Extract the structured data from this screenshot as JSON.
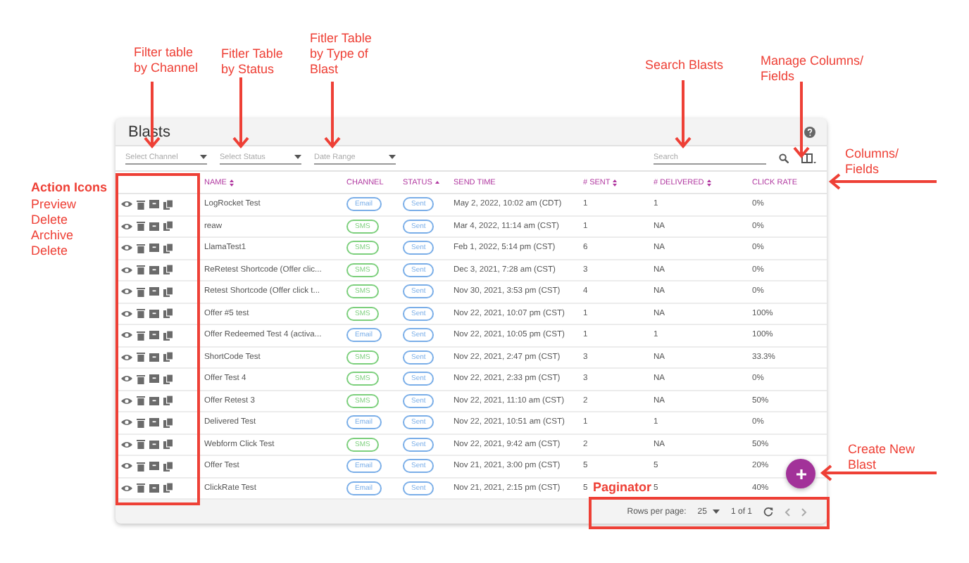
{
  "panel": {
    "title": "Blasts",
    "filters": [
      {
        "placeholder": "Select Channel"
      },
      {
        "placeholder": "Select Status"
      },
      {
        "placeholder": "Date Range"
      }
    ],
    "search": {
      "placeholder": "Search"
    },
    "columns": [
      {
        "label": "NAME",
        "sortable": true,
        "sorted": false
      },
      {
        "label": "CHANNEL",
        "sortable": false
      },
      {
        "label": "STATUS",
        "sortable": true,
        "sorted": true
      },
      {
        "label": "SEND TIME",
        "sortable": false
      },
      {
        "label": "# SENT",
        "sortable": true,
        "sorted": false
      },
      {
        "label": "# DELIVERED",
        "sortable": true,
        "sorted": false
      },
      {
        "label": "CLICK RATE",
        "sortable": false
      }
    ],
    "rows": [
      {
        "name": "LogRocket Test",
        "channel": {
          "label": "Email",
          "color": "#7aaee8"
        },
        "status": "Sent",
        "send_time": "May 2, 2022, 10:02 am (CDT)",
        "sent": "1",
        "delivered": "1",
        "click_rate": "0%"
      },
      {
        "name": "reaw",
        "channel": {
          "label": "SMS",
          "color": "#7ccf7c"
        },
        "status": "Sent",
        "send_time": "Mar 4, 2022, 11:14 am (CST)",
        "sent": "1",
        "delivered": "NA",
        "click_rate": "0%"
      },
      {
        "name": "LlamaTest1",
        "channel": {
          "label": "SMS",
          "color": "#7ccf7c"
        },
        "status": "Sent",
        "send_time": "Feb 1, 2022, 5:14 pm (CST)",
        "sent": "6",
        "delivered": "NA",
        "click_rate": "0%"
      },
      {
        "name": "ReRetest Shortcode (Offer clic...",
        "channel": {
          "label": "SMS",
          "color": "#7ccf7c"
        },
        "status": "Sent",
        "send_time": "Dec 3, 2021, 7:28 am (CST)",
        "sent": "3",
        "delivered": "NA",
        "click_rate": "0%"
      },
      {
        "name": "Retest Shortcode (Offer click t...",
        "channel": {
          "label": "SMS",
          "color": "#7ccf7c"
        },
        "status": "Sent",
        "send_time": "Nov 30, 2021, 3:53 pm (CST)",
        "sent": "4",
        "delivered": "NA",
        "click_rate": "0%"
      },
      {
        "name": "Offer #5 test",
        "channel": {
          "label": "SMS",
          "color": "#7ccf7c"
        },
        "status": "Sent",
        "send_time": "Nov 22, 2021, 10:07 pm (CST)",
        "sent": "1",
        "delivered": "NA",
        "click_rate": "100%"
      },
      {
        "name": "Offer Redeemed Test 4 (activa...",
        "channel": {
          "label": "Email",
          "color": "#7aaee8"
        },
        "status": "Sent",
        "send_time": "Nov 22, 2021, 10:05 pm (CST)",
        "sent": "1",
        "delivered": "1",
        "click_rate": "100%"
      },
      {
        "name": "ShortCode Test",
        "channel": {
          "label": "SMS",
          "color": "#7ccf7c"
        },
        "status": "Sent",
        "send_time": "Nov 22, 2021, 2:47 pm (CST)",
        "sent": "3",
        "delivered": "NA",
        "click_rate": "33.3%"
      },
      {
        "name": "Offer Test 4",
        "channel": {
          "label": "SMS",
          "color": "#7ccf7c"
        },
        "status": "Sent",
        "send_time": "Nov 22, 2021, 2:33 pm (CST)",
        "sent": "3",
        "delivered": "NA",
        "click_rate": "0%"
      },
      {
        "name": "Offer Retest 3",
        "channel": {
          "label": "SMS",
          "color": "#7ccf7c"
        },
        "status": "Sent",
        "send_time": "Nov 22, 2021, 11:10 am (CST)",
        "sent": "2",
        "delivered": "NA",
        "click_rate": "50%"
      },
      {
        "name": "Delivered Test",
        "channel": {
          "label": "Email",
          "color": "#7aaee8"
        },
        "status": "Sent",
        "send_time": "Nov 22, 2021, 10:51 am (CST)",
        "sent": "1",
        "delivered": "1",
        "click_rate": "0%"
      },
      {
        "name": "Webform Click Test",
        "channel": {
          "label": "SMS",
          "color": "#7ccf7c"
        },
        "status": "Sent",
        "send_time": "Nov 22, 2021, 9:42 am (CST)",
        "sent": "2",
        "delivered": "NA",
        "click_rate": "50%"
      },
      {
        "name": "Offer Test",
        "channel": {
          "label": "Email",
          "color": "#7aaee8"
        },
        "status": "Sent",
        "send_time": "Nov 21, 2021, 3:00 pm (CST)",
        "sent": "5",
        "delivered": "5",
        "click_rate": "20%"
      },
      {
        "name": "ClickRate Test",
        "channel": {
          "label": "Email",
          "color": "#7aaee8"
        },
        "status": "Sent",
        "send_time": "Nov 21, 2021, 2:15 pm (CST)",
        "sent": "5",
        "delivered": "5",
        "click_rate": "40%"
      }
    ],
    "paginator": {
      "rows_per_page_label": "Rows per page:",
      "rows_per_page": "25",
      "range": "1 of 1"
    }
  },
  "annotations": [
    {
      "kind": "callout",
      "text": "Filter table\nby Channel"
    },
    {
      "kind": "callout",
      "text": "Fitler Table\nby Status"
    },
    {
      "kind": "callout",
      "text": "Fitler Table\nby Type of\nBlast"
    },
    {
      "kind": "callout",
      "text": "Search Blasts"
    },
    {
      "kind": "callout",
      "text": "Manage Columns/\nFields"
    },
    {
      "kind": "callout",
      "text": "Columns/\nFields"
    },
    {
      "kind": "heading",
      "text": "Action Icons"
    },
    {
      "kind": "callout",
      "text": "Preview\nDelete\nArchive\nDelete"
    },
    {
      "kind": "heading",
      "text": "Paginator"
    },
    {
      "kind": "callout",
      "text": "Create New\nBlast"
    }
  ]
}
